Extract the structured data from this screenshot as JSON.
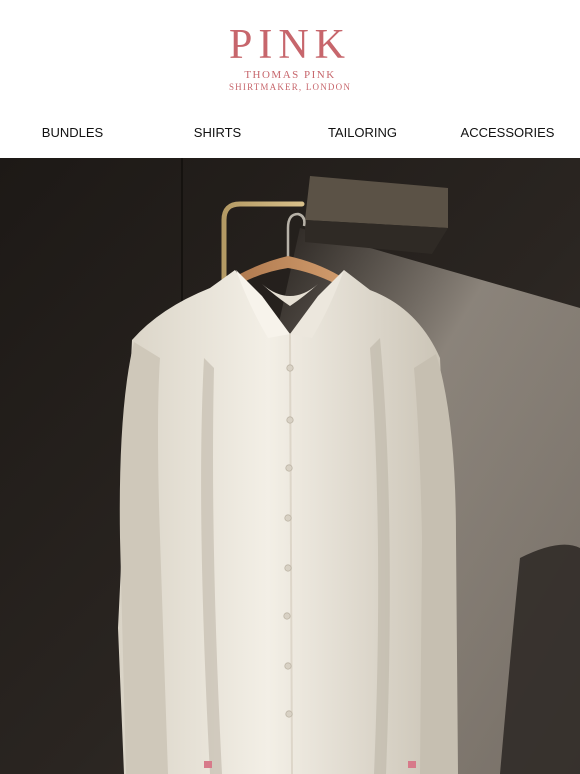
{
  "brand": {
    "logo_main": "PINK",
    "logo_sub": "THOMAS PINK",
    "logo_tagline": "SHIRTMAKER, LONDON",
    "accent_color": "#c7666c"
  },
  "nav": {
    "items": [
      {
        "label": "BUNDLES"
      },
      {
        "label": "SHIRTS"
      },
      {
        "label": "TAILORING"
      },
      {
        "label": "ACCESSORIES"
      }
    ]
  },
  "hero": {
    "subject": "white-dress-shirt-on-wooden-hanger",
    "background_color": "#2a2521"
  }
}
